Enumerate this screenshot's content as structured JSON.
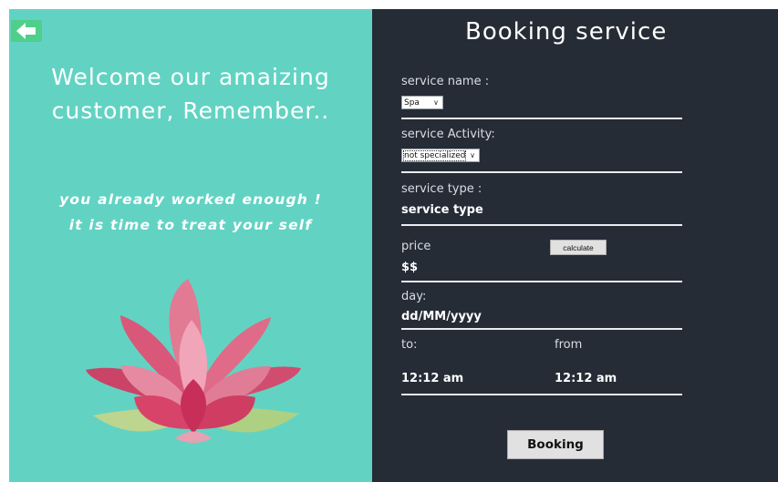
{
  "left": {
    "welcome_line1": "Welcome our amaizing",
    "welcome_line2": "customer, Remember..",
    "tag_line1": "you already worked enough !",
    "tag_line2": "it is time to treat your self",
    "back_icon": "back-arrow-icon",
    "image": "lotus-flower"
  },
  "form": {
    "title": "Booking service",
    "service_name_label": "service name :",
    "service_name_value": "Spa",
    "service_activity_label": "service Activity:",
    "service_activity_value": "not specialized",
    "service_type_label": "service type :",
    "service_type_value": "service type",
    "price_label": "price",
    "price_value": "$$",
    "calculate_label": "calculate",
    "day_label": "day:",
    "day_value": "dd/MM/yyyy",
    "to_label": "to:",
    "from_label": "from",
    "to_value": "12:12 am",
    "from_value": "12:12 am",
    "booking_label": "Booking"
  },
  "colors": {
    "left_panel": "#62d3c3",
    "right_panel": "#252c36",
    "back_button": "#4fcf8a"
  }
}
